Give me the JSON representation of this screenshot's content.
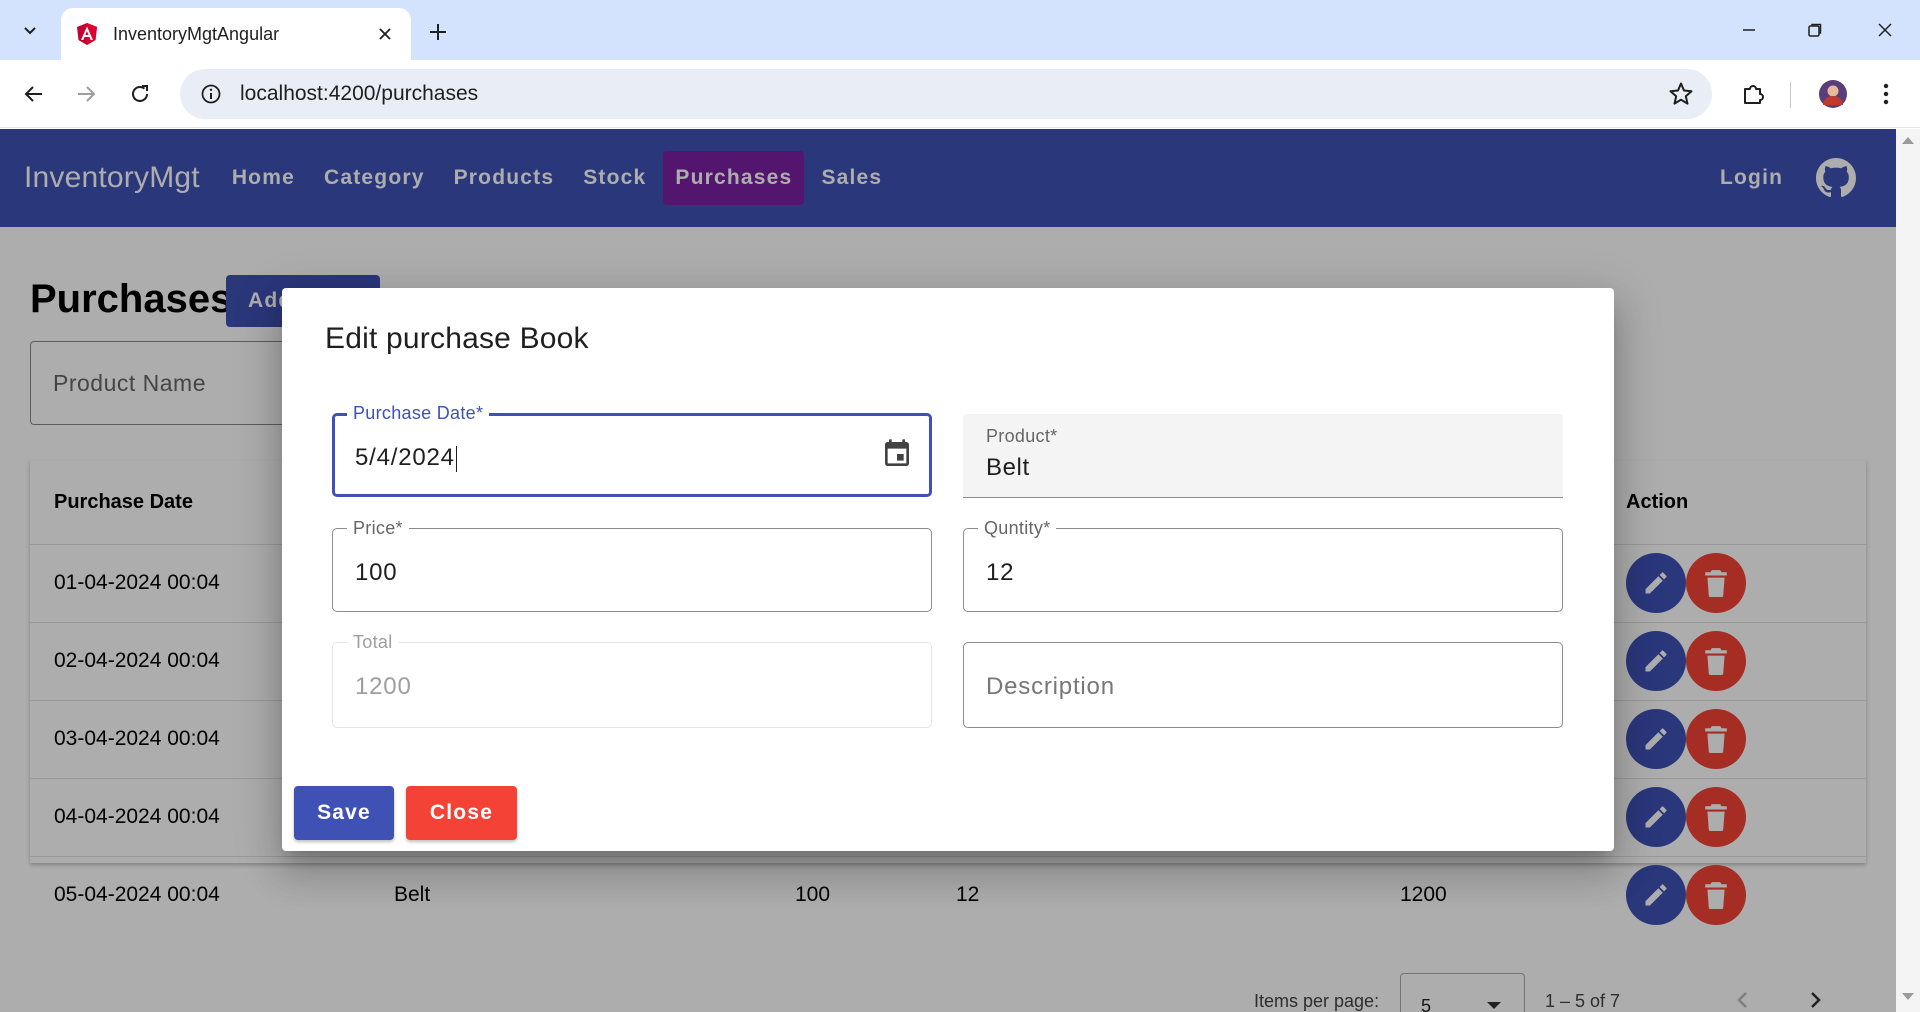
{
  "browser": {
    "tab_title": "InventoryMgtAngular",
    "url": "localhost:4200/purchases"
  },
  "navbar": {
    "brand": "InventoryMgt",
    "links": [
      "Home",
      "Category",
      "Products",
      "Stock",
      "Purchases",
      "Sales"
    ],
    "active": "Purchases",
    "login": "Login"
  },
  "page": {
    "title": "Purchases",
    "add_button": "Add",
    "search_placeholder": "Product Name"
  },
  "table": {
    "columns": {
      "purchase_date": "Purchase Date",
      "action": "Action"
    },
    "rows": [
      {
        "date": "01-04-2024 00:04"
      },
      {
        "date": "02-04-2024 00:04"
      },
      {
        "date": "03-04-2024 00:04"
      },
      {
        "date": "04-04-2024 00:04"
      },
      {
        "date": "05-04-2024 00:04",
        "product": "Belt",
        "price": "100",
        "qty": "12",
        "total": "1200"
      }
    ]
  },
  "paginator": {
    "label": "Items per page:",
    "page_size": "5",
    "range": "1 – 5 of 7"
  },
  "dialog": {
    "title": "Edit purchase Book",
    "purchase_date": {
      "label": "Purchase Date*",
      "value": "5/4/2024"
    },
    "product": {
      "label": "Product*",
      "value": "Belt"
    },
    "price": {
      "label": "Price*",
      "value": "100"
    },
    "quantity": {
      "label": "Quntity*",
      "value": "12"
    },
    "total": {
      "label": "Total",
      "value": "1200"
    },
    "description": {
      "placeholder": "Description"
    },
    "save": "Save",
    "close": "Close"
  },
  "colors": {
    "primary": "#3f51b5",
    "active_nav": "#7b1fa2",
    "warn": "#f44336"
  }
}
